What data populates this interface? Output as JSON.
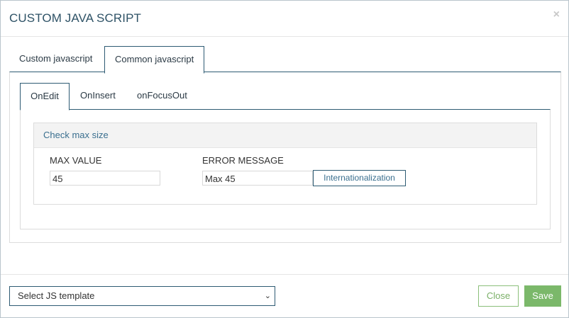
{
  "dialog": {
    "title": "CUSTOM JAVA SCRIPT",
    "close_glyph": "×"
  },
  "outer_tabs": [
    {
      "label": "Custom javascript",
      "active": false
    },
    {
      "label": "Common javascript",
      "active": true
    }
  ],
  "inner_tabs": [
    {
      "label": "OnEdit",
      "active": true
    },
    {
      "label": "OnInsert",
      "active": false
    },
    {
      "label": "onFocusOut",
      "active": false
    }
  ],
  "card": {
    "title": "Check max size",
    "max_value_label": "MAX VALUE",
    "max_value": "45",
    "error_message_label": "ERROR MESSAGE",
    "error_message": "Max 45",
    "internationalization_label": "Internationalization"
  },
  "footer": {
    "template_select": "Select JS template",
    "close_label": "Close",
    "save_label": "Save"
  },
  "colors": {
    "accent": "#2e5b73",
    "link": "#3a6f8f",
    "save": "#7bb86a"
  }
}
